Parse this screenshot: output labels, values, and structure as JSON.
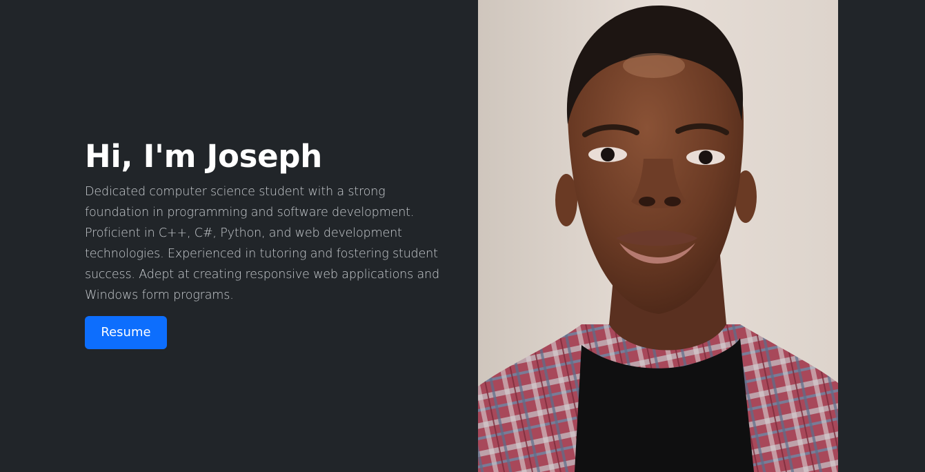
{
  "hero": {
    "title": "Hi, I'm Joseph",
    "description": "Dedicated computer science student with a strong foundation in programming and software development. Proficient in C++, C#, Python, and web development technologies. Experienced in tutoring and fostering student success. Adept at creating responsive web applications and Windows form programs.",
    "resume_label": "Resume"
  },
  "colors": {
    "background": "#212529",
    "accent": "#0d6efd",
    "title_text": "#ffffff",
    "body_text": "#c9cdd1"
  }
}
